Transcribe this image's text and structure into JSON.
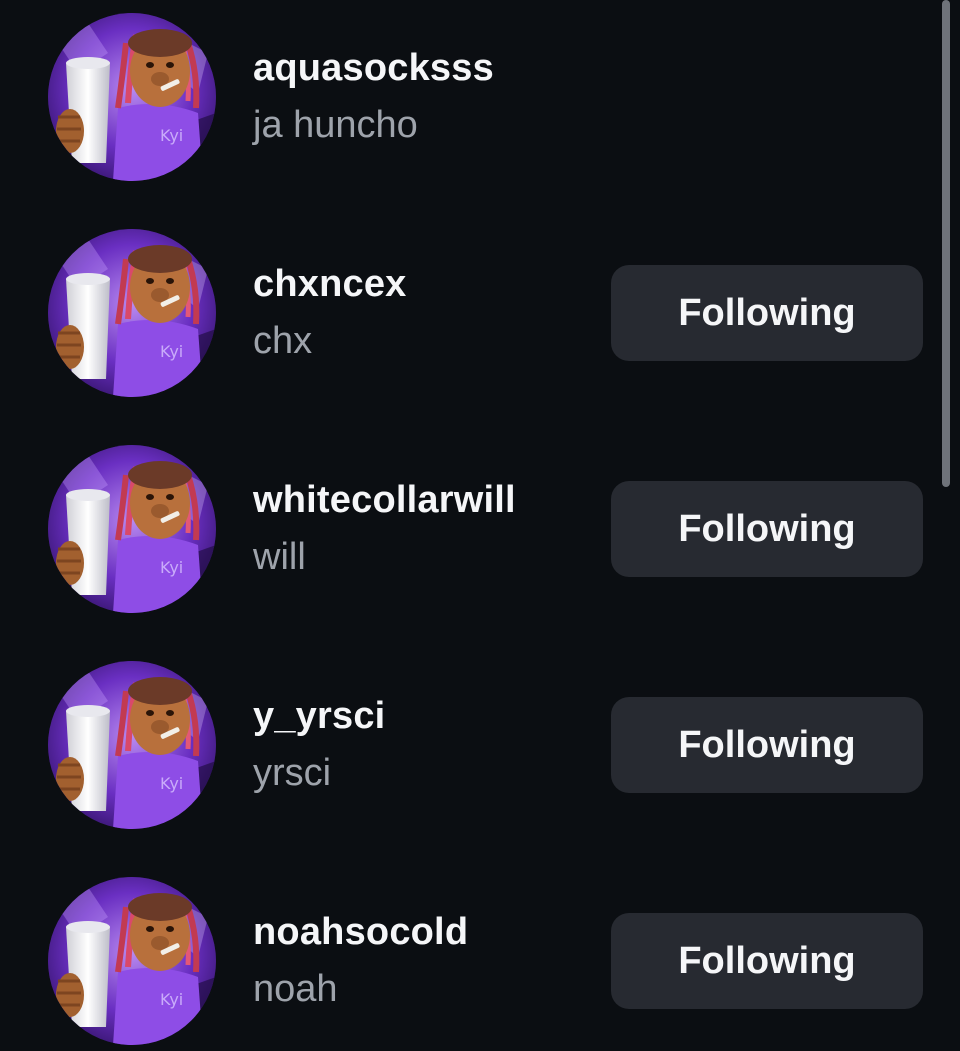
{
  "accounts": [
    {
      "username": "aquasocksss",
      "full_name": "ja huncho",
      "button_label": ""
    },
    {
      "username": "chxncex",
      "full_name": "chx",
      "button_label": "Following"
    },
    {
      "username": "whitecollarwill",
      "full_name": "will",
      "button_label": "Following"
    },
    {
      "username": "y_yrsci",
      "full_name": "yrsci",
      "button_label": "Following"
    },
    {
      "username": "noahsocold",
      "full_name": "noah",
      "button_label": "Following"
    }
  ],
  "icons": {
    "avatar": "profile-picture-cartoon-character"
  },
  "colors": {
    "background": "#0b0e12",
    "username_text": "#f5f6f8",
    "fullname_text": "#9ea3ab",
    "button_bg": "#272a31",
    "avatar_accent": "#7b3fd4"
  }
}
